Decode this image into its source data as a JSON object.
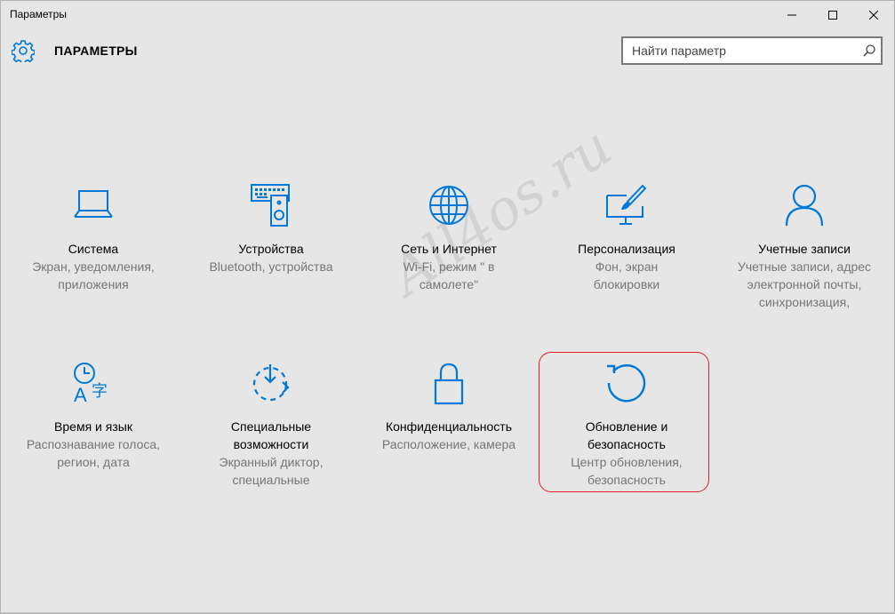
{
  "window": {
    "title": "Параметры",
    "buttons": {
      "minimize": "minimize-icon",
      "maximize": "maximize-icon",
      "close": "close-icon"
    }
  },
  "header": {
    "icon": "gear-icon",
    "title": "ПАРАМЕТРЫ"
  },
  "search": {
    "placeholder": "Найти параметр",
    "value": "",
    "icon": "search-icon"
  },
  "tiles": [
    {
      "name": "Система",
      "desc_lines": [
        "Экран, уведомления,",
        "приложения"
      ],
      "icon": "laptop-icon"
    },
    {
      "name": "Устройства",
      "desc_lines": [
        "Bluetooth, устройства"
      ],
      "icon": "devices-icon"
    },
    {
      "name": "Сеть и Интернет",
      "desc_lines": [
        "Wi-Fi, режим \" в",
        "самолете\""
      ],
      "icon": "globe-icon"
    },
    {
      "name": "Персонализация",
      "desc_lines": [
        "Фон, экран",
        "блокировки"
      ],
      "icon": "personalization-icon"
    },
    {
      "name": "Учетные записи",
      "desc_lines": [
        "Учетные записи, адрес",
        "электронной почты,",
        "синхронизация,"
      ],
      "icon": "user-icon"
    },
    {
      "name": "Время и язык",
      "desc_lines": [
        "Распознавание голоса,",
        "регион, дата"
      ],
      "icon": "time-language-icon"
    },
    {
      "name_lines": [
        "Специальные",
        "возможности"
      ],
      "desc_lines": [
        "Экранный диктор,",
        "специальные"
      ],
      "icon": "accessibility-icon"
    },
    {
      "name": "Конфиденциальность",
      "desc_lines": [
        "Расположение, камера"
      ],
      "icon": "lock-icon"
    },
    {
      "name_lines": [
        "Обновление и",
        "безопасность"
      ],
      "desc_lines": [
        "Центр обновления,",
        "безопасность"
      ],
      "icon": "update-icon"
    }
  ],
  "watermark": "All4os.ru",
  "colors": {
    "accent": "#0078d7",
    "highlight": "#e0202a",
    "background": "#e6e6e6"
  }
}
